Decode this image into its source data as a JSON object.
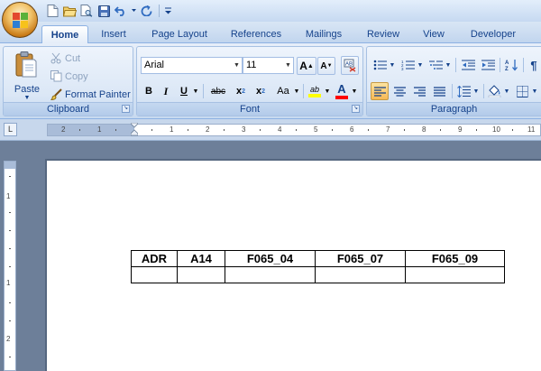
{
  "titlebar": {
    "qat_icons": [
      "new-document-icon",
      "open-folder-icon",
      "print-preview-icon",
      "save-icon",
      "undo-icon",
      "undo-dropdown-icon",
      "redo-icon",
      "customize-qat-icon"
    ]
  },
  "tabs": [
    {
      "label": "Home",
      "active": true
    },
    {
      "label": "Insert"
    },
    {
      "label": "Page Layout"
    },
    {
      "label": "References"
    },
    {
      "label": "Mailings"
    },
    {
      "label": "Review"
    },
    {
      "label": "View"
    },
    {
      "label": "Developer"
    }
  ],
  "clipboard": {
    "paste_label": "Paste",
    "cut_label": "Cut",
    "copy_label": "Copy",
    "format_painter_label": "Format Painter",
    "group_label": "Clipboard"
  },
  "font": {
    "font_name": "Arial",
    "font_size": "11",
    "grow_label": "A",
    "shrink_label": "A",
    "bold_label": "B",
    "italic_label": "I",
    "underline_label": "U",
    "strike_label": "abc",
    "subscript_label": "x",
    "superscript_label": "x",
    "change_case_label": "Aa",
    "highlight_label": "ab",
    "font_color_label": "A",
    "group_label": "Font"
  },
  "paragraph": {
    "group_label": "Paragraph"
  },
  "ruler": {
    "h_numbers": [
      "2",
      "1",
      "1",
      "2",
      "3",
      "4",
      "5",
      "6",
      "7",
      "8",
      "9",
      "10",
      "11"
    ],
    "v_numbers": [
      "1",
      "2"
    ]
  },
  "document": {
    "table": {
      "headers": [
        "ADR",
        "A14",
        "F065_04",
        "F065_07",
        "F065_09"
      ],
      "rows": [
        [
          "",
          "",
          "",
          "",
          ""
        ]
      ]
    }
  },
  "colors": {
    "highlight": "#ffff00",
    "font_color": "#ff0000",
    "ribbon_text": "#15428b"
  }
}
